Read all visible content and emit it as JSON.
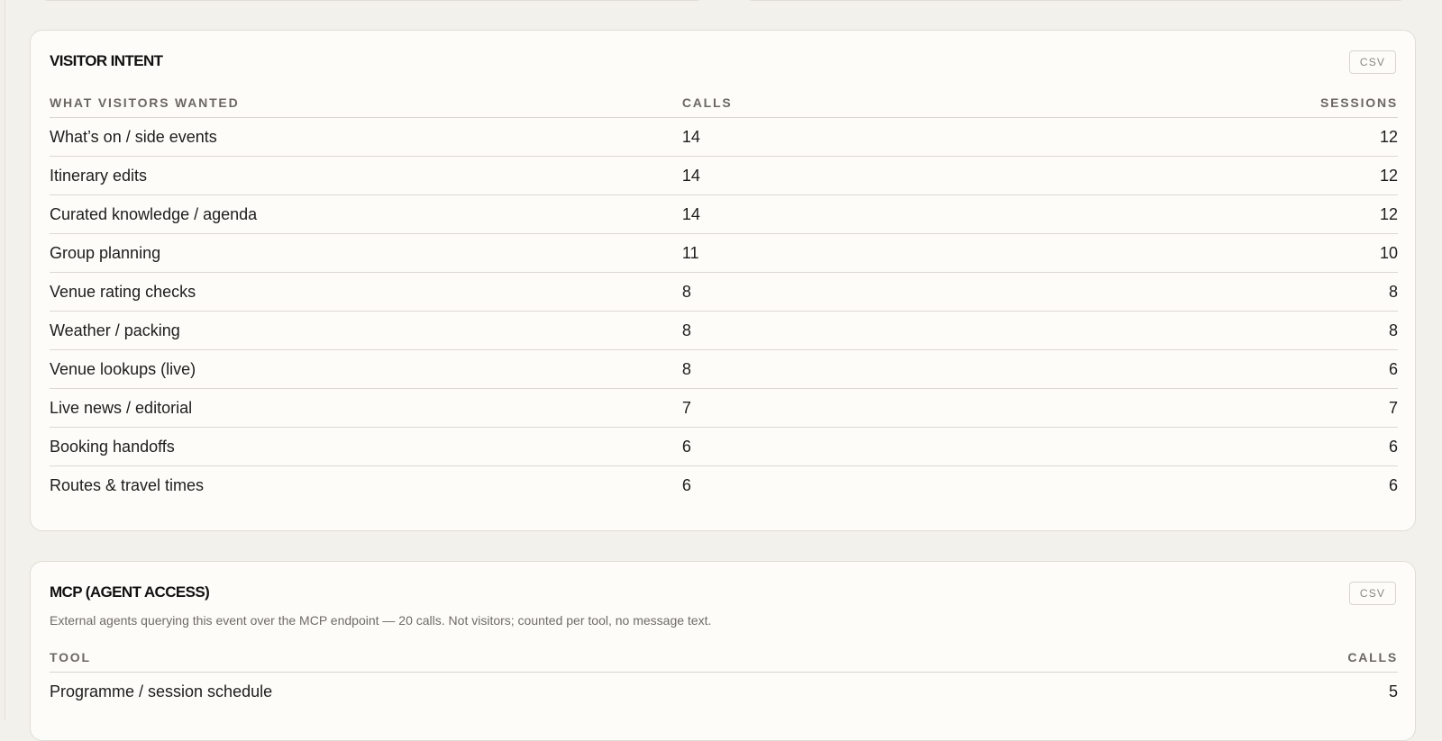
{
  "visitor_intent": {
    "title": "VISITOR INTENT",
    "csv_label": "CSV",
    "columns": [
      "WHAT VISITORS WANTED",
      "CALLS",
      "SESSIONS"
    ],
    "rows": [
      {
        "label": "What’s on / side events",
        "calls": "14",
        "sessions": "12"
      },
      {
        "label": "Itinerary edits",
        "calls": "14",
        "sessions": "12"
      },
      {
        "label": "Curated knowledge / agenda",
        "calls": "14",
        "sessions": "12"
      },
      {
        "label": "Group planning",
        "calls": "11",
        "sessions": "10"
      },
      {
        "label": "Venue rating checks",
        "calls": "8",
        "sessions": "8"
      },
      {
        "label": "Weather / packing",
        "calls": "8",
        "sessions": "8"
      },
      {
        "label": "Venue lookups (live)",
        "calls": "8",
        "sessions": "6"
      },
      {
        "label": "Live news / editorial",
        "calls": "7",
        "sessions": "7"
      },
      {
        "label": "Booking handoffs",
        "calls": "6",
        "sessions": "6"
      },
      {
        "label": "Routes & travel times",
        "calls": "6",
        "sessions": "6"
      }
    ]
  },
  "mcp": {
    "title": "MCP (AGENT ACCESS)",
    "csv_label": "CSV",
    "subtitle": "External agents querying this event over the MCP endpoint — 20 calls. Not visitors; counted per tool, no message text.",
    "columns": [
      "TOOL",
      "CALLS"
    ],
    "rows": [
      {
        "label": "Programme / session schedule",
        "calls": "5"
      }
    ]
  }
}
